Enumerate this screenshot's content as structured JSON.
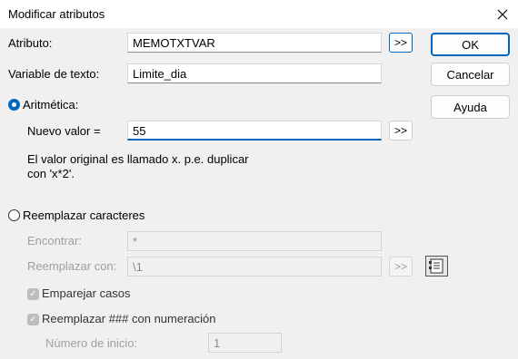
{
  "window": {
    "title": "Modificar atributos",
    "close_glyph": "✕"
  },
  "attribute": {
    "label": "Atributo:",
    "value": "MEMOTXTVAR",
    "pick_label": ">>"
  },
  "text_variable": {
    "label": "Variable de texto:",
    "value": "Limite_dia"
  },
  "buttons": {
    "ok": "OK",
    "cancel": "Cancelar",
    "help": "Ayuda"
  },
  "arithmetic": {
    "label": "Aritmética:",
    "selected": true,
    "new_value_label": "Nuevo valor =",
    "new_value": "55",
    "pick_label": ">>",
    "hint_line1": "El valor original es llamado x. p.e. duplicar",
    "hint_line2": "con 'x*2'."
  },
  "replace": {
    "label": "Reemplazar caracteres",
    "selected": false,
    "find_label": "Encontrar:",
    "find_value": "*",
    "replace_label": "Reemplazar con:",
    "replace_value": "\\1",
    "pick_label": ">>",
    "expression_icon": "list-editor-icon",
    "match_case_label": "Emparejar casos",
    "match_case_checked": true,
    "numbering_label": "Reemplazar ### con numeración",
    "numbering_checked": true,
    "start_number_label": "Número de inicio:",
    "start_number_value": "1"
  },
  "colors": {
    "accent": "#0067c0",
    "disabled_text": "#a0a0a0",
    "background": "#f0f0f0"
  }
}
